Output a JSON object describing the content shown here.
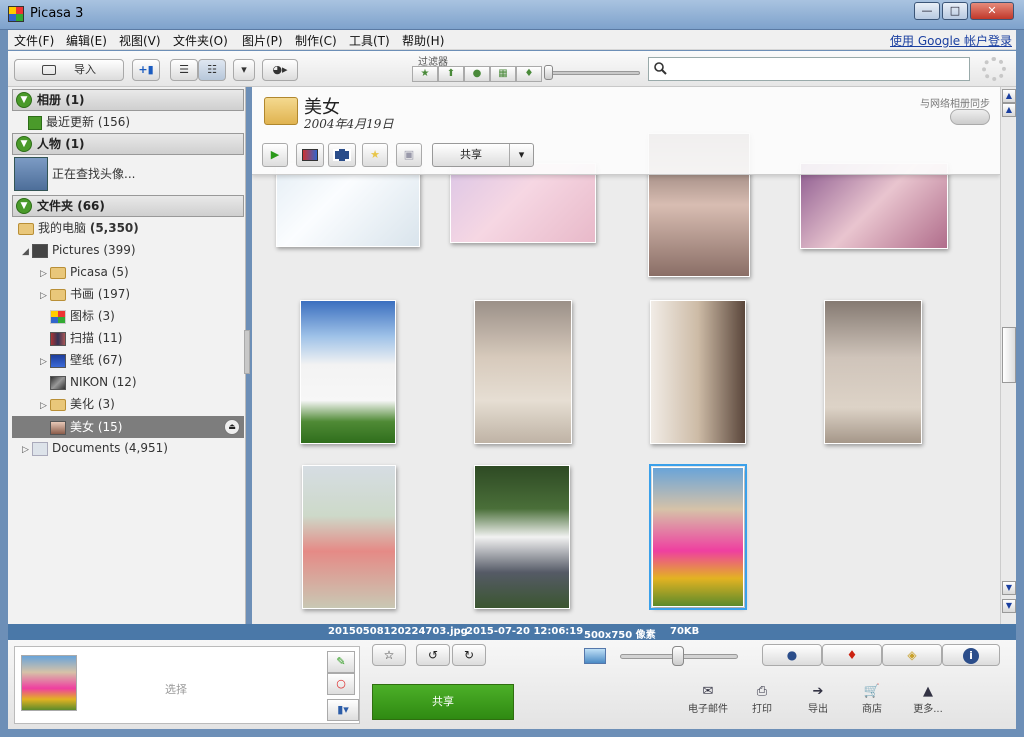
{
  "window": {
    "title": "Picasa 3",
    "controls": {
      "minimize": "—",
      "maximize": "□",
      "close": "✕"
    }
  },
  "menu": {
    "items": [
      "文件(F)",
      "编辑(E)",
      "视图(V)",
      "文件夹(O)",
      "图片(P)",
      "制作(C)",
      "工具(T)",
      "帮助(H)"
    ],
    "account_link": "使用 Google 帐户登录"
  },
  "toolbar": {
    "import_label": "导入",
    "filter_label": "过滤器",
    "search_placeholder": ""
  },
  "sidebar": {
    "sections": [
      {
        "label": "相册",
        "count": "(1)"
      },
      {
        "label": "人物",
        "count": "(1)"
      },
      {
        "label": "文件夹",
        "count": "(66)"
      }
    ],
    "recent_label": "最近更新 (156)",
    "people_label": "正在查找头像...",
    "tree": [
      {
        "label": "我的电脑",
        "count": "(5,350)"
      },
      {
        "label": "Pictures (399)"
      },
      {
        "label": "Picasa (5)"
      },
      {
        "label": "书画 (197)"
      },
      {
        "label": "图标 (3)"
      },
      {
        "label": "扫描 (11)"
      },
      {
        "label": "壁纸 (67)"
      },
      {
        "label": "NIKON (12)"
      },
      {
        "label": "美化 (3)"
      },
      {
        "label": "美女 (15)"
      },
      {
        "label": "Documents (4,951)"
      }
    ]
  },
  "album": {
    "title": "美女",
    "date": "2004年4月19日",
    "sync_label": "与网络相册同步",
    "share_label": "共享"
  },
  "status": {
    "filename": "20150508120224703.jpg",
    "datetime": "2015-07-20 12:06:19",
    "dimensions": "500x750 像素",
    "size": "70KB"
  },
  "tray": {
    "select_label": "选择",
    "share_button": "共享",
    "actions": [
      "电子邮件",
      "打印",
      "导出",
      "商店",
      "更多..."
    ]
  },
  "colors": {
    "accent_green": "#3a9a1c",
    "status_blue": "#4a78a8",
    "selection_blue": "#3aa0ea"
  }
}
